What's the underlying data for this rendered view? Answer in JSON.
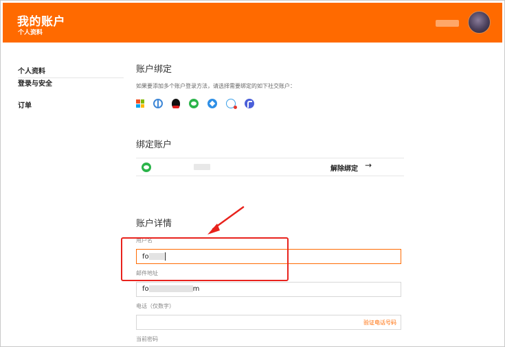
{
  "header": {
    "title": "我的账户",
    "subtitle": "个人资料",
    "accent": "#ff6a00"
  },
  "sidebar": {
    "items": [
      {
        "label": "个人资料",
        "active": true
      },
      {
        "label": "登录与安全",
        "active": false
      },
      {
        "label": "订单",
        "active": false
      }
    ]
  },
  "binding": {
    "title": "账户绑定",
    "hint": "如果要添加多个账户登录方法，请选择需要绑定的如下社交账户：",
    "icons": [
      "microsoft-icon",
      "globe-icon",
      "qq-icon",
      "wechat-icon",
      "weibo-icon",
      "message-icon",
      "feather-icon"
    ]
  },
  "bound": {
    "title": "绑定账户",
    "account_icon": "wechat-icon",
    "unbind_label": "解除绑定",
    "arrow": "→"
  },
  "details": {
    "title": "账户详情",
    "username_label": "用户名",
    "username_value_start": "fo",
    "email_label": "邮件地址",
    "email_value_start": "fo",
    "email_value_end": "m",
    "phone_label": "电话（仅数字）",
    "verify_label": "验证电话号码",
    "password_label": "当前密码"
  },
  "annotation": {
    "color": "#e8221c"
  }
}
